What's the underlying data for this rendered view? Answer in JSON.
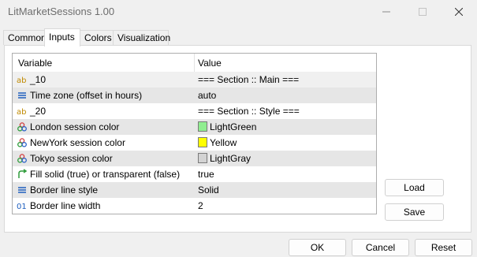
{
  "window": {
    "title": "LitMarketSessions 1.00"
  },
  "tabs": [
    {
      "label": "Common"
    },
    {
      "label": "Inputs"
    },
    {
      "label": "Colors"
    },
    {
      "label": "Visualization"
    }
  ],
  "grid": {
    "headers": {
      "variable": "Variable",
      "value": "Value"
    },
    "rows": [
      {
        "icon": "string-ab-icon",
        "variable": "_10",
        "value": "=== Section :: Main ==="
      },
      {
        "icon": "enum-list-icon",
        "variable": "Time zone (offset in hours)",
        "value": "auto"
      },
      {
        "icon": "string-ab-icon",
        "variable": "_20",
        "value": "=== Section :: Style ==="
      },
      {
        "icon": "color-palette-icon",
        "variable": "London session color",
        "value": "LightGreen",
        "color": "#90ee90"
      },
      {
        "icon": "color-palette-icon",
        "variable": "NewYork session color",
        "value": "Yellow",
        "color": "#ffff00"
      },
      {
        "icon": "color-palette-icon",
        "variable": "Tokyo session color",
        "value": "LightGray",
        "color": "#d3d3d3"
      },
      {
        "icon": "bool-arrow-icon",
        "variable": "Fill solid (true) or transparent (false)",
        "value": "true"
      },
      {
        "icon": "enum-list-icon",
        "variable": "Border line style",
        "value": "Solid"
      },
      {
        "icon": "integer-01-icon",
        "variable": "Border line width",
        "value": "2"
      }
    ]
  },
  "side_buttons": {
    "load": "Load",
    "save": "Save"
  },
  "footer_buttons": {
    "ok": "OK",
    "cancel": "Cancel",
    "reset": "Reset"
  }
}
